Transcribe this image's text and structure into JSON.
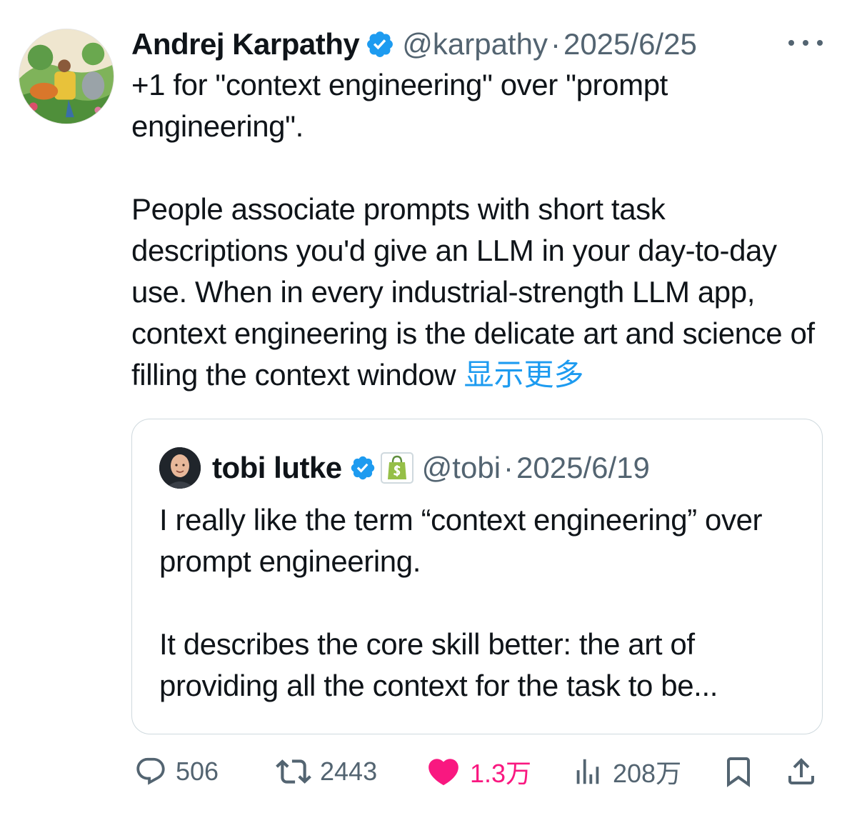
{
  "tweet": {
    "author": {
      "name": "Andrej Karpathy",
      "handle": "@karpathy",
      "separator": "·",
      "date": "2025/6/25"
    },
    "text": {
      "paragraph1": "+1 for \"context engineering\" over \"prompt engineering\".",
      "paragraph2": "People associate prompts with short task descriptions you'd give an LLM in your day-to-day use. When in every industrial-strength LLM app, context engineering is the delicate art and science of filling the context window",
      "show_more": "显示更多"
    },
    "quote": {
      "author": {
        "name": "tobi lutke",
        "handle": "@tobi",
        "separator": "·",
        "date": "2025/6/19"
      },
      "paragraph1": "I really like the term “context engineering” over prompt engineering.",
      "paragraph2": "It describes the core skill better: the art of providing all the context for the task to be..."
    },
    "actions": {
      "replies": "506",
      "retweets": "2443",
      "likes": "1.3万",
      "views": "208万"
    }
  },
  "colors": {
    "verified": "#1d9bf0",
    "link": "#1d9bf0",
    "like": "#f91880",
    "muted": "#536471",
    "shopify": "#95bf47"
  },
  "icons": [
    "verified-badge-icon",
    "more-icon",
    "shopify-badge-icon",
    "reply-icon",
    "retweet-icon",
    "heart-icon",
    "views-icon",
    "bookmark-icon",
    "share-icon"
  ]
}
